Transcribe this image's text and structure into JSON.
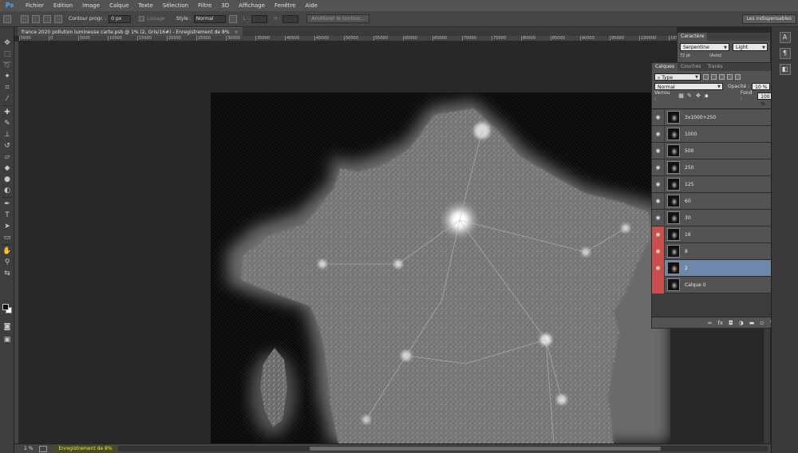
{
  "app": {
    "logo": "Ps"
  },
  "menu": [
    "Fichier",
    "Edition",
    "Image",
    "Calque",
    "Texte",
    "Sélection",
    "Filtre",
    "3D",
    "Affichage",
    "Fenêtre",
    "Aide"
  ],
  "options_bar": {
    "feather_label": "Contour progr. :",
    "feather_value": "0 px",
    "antialias_label": "Lissage",
    "style_label": "Style :",
    "style_value": "Normal",
    "width_label": "L :",
    "height_label": "H :",
    "refine_button": "Améliorer le contour...",
    "workspace": "Les indispensables"
  },
  "document": {
    "tab_title": "france 2020 pollution lumineuse carte.psb @ 1% (2, Gris/16#) - Enregistrement de 8%",
    "close_glyph": "×",
    "ruler_ticks": [
      "5000",
      "0",
      "5000",
      "10000",
      "15000",
      "20000",
      "25000",
      "30000",
      "35000",
      "40000",
      "45000",
      "50000",
      "55000",
      "60000",
      "65000",
      "70000",
      "75000",
      "80000",
      "85000",
      "90000",
      "95000",
      "100000",
      "105000"
    ]
  },
  "character_panel": {
    "tabs": [
      "Caractère"
    ],
    "font_family": "Serpentine",
    "font_style": "Light",
    "size": "72 pt",
    "leading": "(Auto)"
  },
  "layers_panel": {
    "tabs": [
      "Calques",
      "Couches",
      "Tracés"
    ],
    "filter": "Type",
    "blend_mode": "Normal",
    "opacity_label": "Opacité :",
    "opacity_value": "10 %",
    "lock_label": "Verrou :",
    "fill_label": "Fond :",
    "fill_value": "100 %",
    "layers": [
      {
        "name": "3x1000+250",
        "visible": true,
        "red": false,
        "selected": false
      },
      {
        "name": "1000",
        "visible": true,
        "red": false,
        "selected": false
      },
      {
        "name": "500",
        "visible": true,
        "red": false,
        "selected": false
      },
      {
        "name": "250",
        "visible": true,
        "red": false,
        "selected": false
      },
      {
        "name": "125",
        "visible": true,
        "red": false,
        "selected": false
      },
      {
        "name": "60",
        "visible": true,
        "red": false,
        "selected": false
      },
      {
        "name": "30",
        "visible": true,
        "red": false,
        "selected": false
      },
      {
        "name": "16",
        "visible": true,
        "red": true,
        "selected": false
      },
      {
        "name": "8",
        "visible": true,
        "red": true,
        "selected": false
      },
      {
        "name": "2",
        "visible": true,
        "red": true,
        "selected": true
      },
      {
        "name": "Calque 0",
        "visible": false,
        "red": true,
        "selected": false
      }
    ],
    "footer_icons": [
      "link-icon",
      "fx-icon",
      "mask-icon",
      "adjustment-icon",
      "group-icon",
      "new-layer-icon",
      "trash-icon"
    ]
  },
  "status_bar": {
    "zoom": "1 %",
    "progress_text": "Enregistrement de 8%"
  },
  "colors": {
    "selected_layer": "#6f87a8",
    "layer_warning": "#c94f4f",
    "progress_text": "#f2e93a"
  }
}
